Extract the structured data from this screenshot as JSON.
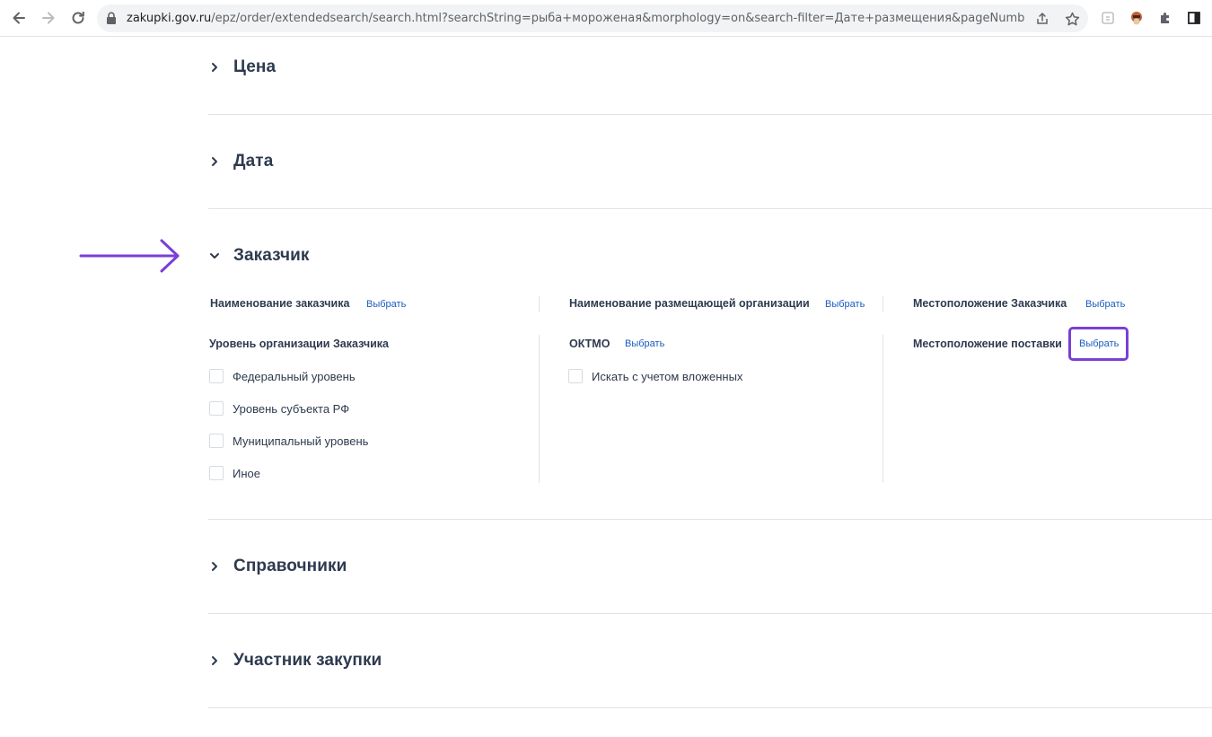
{
  "browser": {
    "url_host": "zakupki.gov.ru",
    "url_rest": "/epz/order/extendedsearch/search.html?searchString=рыба+мороженая&morphology=on&search-filter=Дате+размещения&pageNumber=1..."
  },
  "sections": {
    "price": {
      "title": "Цена"
    },
    "date": {
      "title": "Дата"
    },
    "customer": {
      "title": "Заказчик"
    },
    "directories": {
      "title": "Справочники"
    },
    "participant": {
      "title": "Участник закупки"
    }
  },
  "customer": {
    "col1": {
      "name_label": "Наименование заказчика",
      "name_select": "Выбрать",
      "level_label": "Уровень организации Заказчика",
      "levels": [
        "Федеральный уровень",
        "Уровень субъекта РФ",
        "Муниципальный уровень",
        "Иное"
      ]
    },
    "col2": {
      "org_label": "Наименование размещающей организации",
      "org_select": "Выбрать",
      "oktmo_label": "ОКТМО",
      "oktmo_select": "Выбрать",
      "nested_label": "Искать с учетом вложенных"
    },
    "col3": {
      "location_label": "Местоположение Заказчика",
      "location_select": "Выбрать",
      "delivery_label": "Местоположение поставки",
      "delivery_select": "Выбрать"
    }
  },
  "colors": {
    "annotation": "#7a3fd6",
    "link": "#1a5bbf",
    "text": "#2e3a4f"
  }
}
